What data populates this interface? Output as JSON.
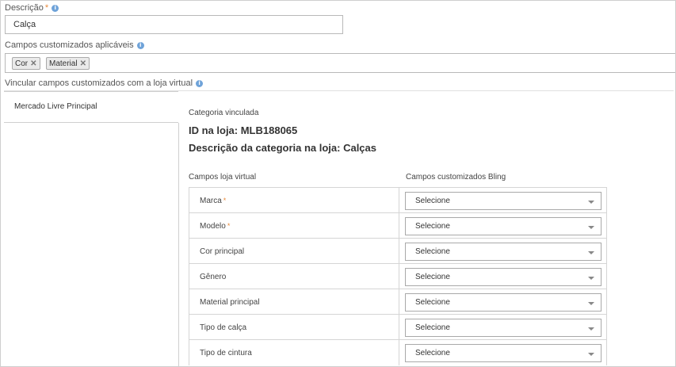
{
  "descricao": {
    "label": "Descrição",
    "required": "*",
    "value": "Calça"
  },
  "campos": {
    "label": "Campos customizados aplicáveis",
    "tags": [
      "Cor",
      "Material"
    ]
  },
  "vincular": {
    "label": "Vincular campos customizados com a loja virtual"
  },
  "tab": {
    "label": "Mercado Livre Principal"
  },
  "categoria": {
    "label": "Categoria vinculada",
    "id_line": "ID na loja: MLB188065",
    "desc_line": "Descrição da categoria na loja: Calças"
  },
  "table": {
    "col1": "Campos loja virtual",
    "col2": "Campos customizados Bling",
    "rows": [
      {
        "name": "Marca",
        "required": "*",
        "value": "Selecione"
      },
      {
        "name": "Modelo",
        "required": "*",
        "value": "Selecione"
      },
      {
        "name": "Cor principal",
        "required": "",
        "value": "Selecione"
      },
      {
        "name": "Gênero",
        "required": "",
        "value": "Selecione"
      },
      {
        "name": "Material principal",
        "required": "",
        "value": "Selecione"
      },
      {
        "name": "Tipo de calça",
        "required": "",
        "value": "Selecione"
      },
      {
        "name": "Tipo de cintura",
        "required": "",
        "value": "Selecione"
      }
    ]
  },
  "colors": {
    "required": "#e8893a",
    "info": "#6fa3d9",
    "border": "#cfcfcf"
  }
}
